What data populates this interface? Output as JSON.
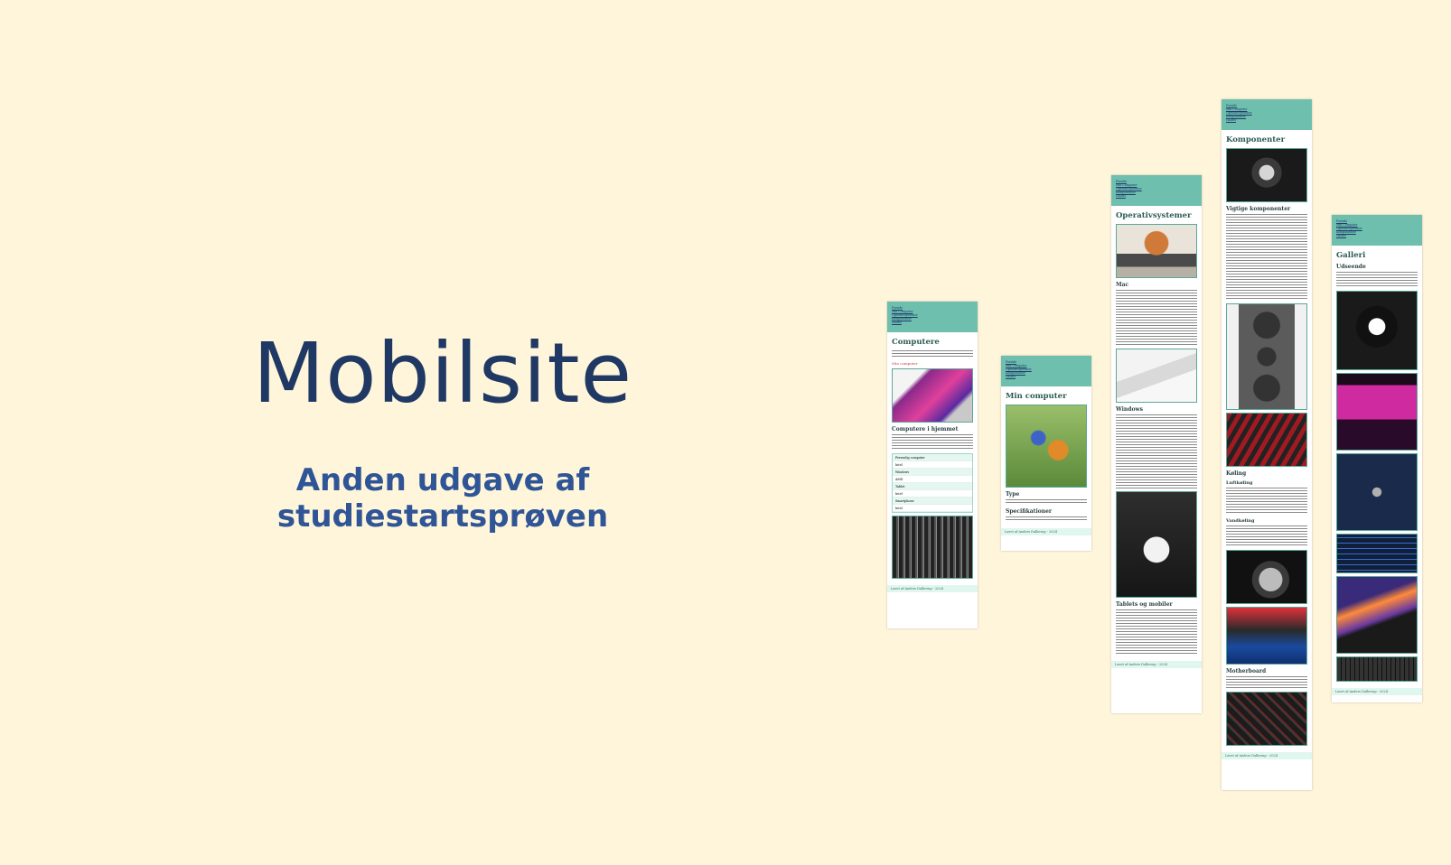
{
  "slide": {
    "title": "Mobilsite",
    "subtitle": "Anden udgave af studiestartsprøven"
  },
  "nav_items": [
    "Forside",
    "Min Computer",
    "Operativsystemer",
    "Komponenter",
    "Galleri"
  ],
  "footer": "Lavet af Anders Dalberup - 2024",
  "pages": {
    "computere": {
      "title": "Computere",
      "link": "Min computer",
      "h2": "Computere i hjemmet",
      "table": [
        "Personlig computer",
        "Intel",
        "Windows",
        "AMD",
        "Tablet",
        "Intel",
        "Smartphone",
        "Intel"
      ]
    },
    "min_computer": {
      "title": "Min computer",
      "h2a": "Type",
      "h2b": "Specifikationer"
    },
    "operativsystemer": {
      "title": "Operativsystemer",
      "h2a": "Mac",
      "h2b": "Windows",
      "h2c": "Tablets og mobiler"
    },
    "komponenter": {
      "title": "Komponenter",
      "h2a": "Vigtige komponenter",
      "h2b": "Køling",
      "h3a": "Luftkøling",
      "h3b": "Vandkøling",
      "h2c": "Motherboard"
    },
    "galleri": {
      "title": "Galleri",
      "h2": "Udseende"
    }
  }
}
